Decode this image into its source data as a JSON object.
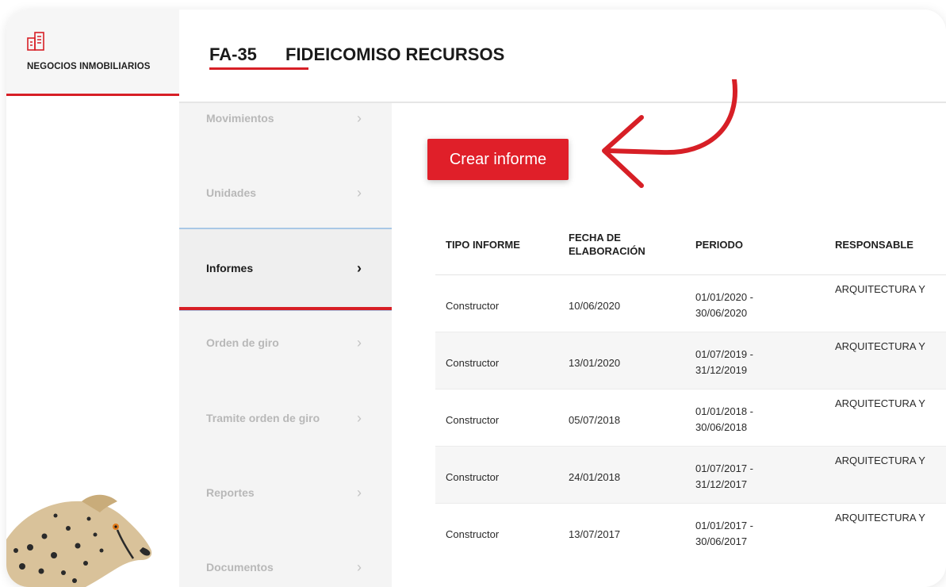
{
  "brand": {
    "name": "NEGOCIOS INMOBILIARIOS",
    "icon": "building-icon",
    "accent": "#d71f26"
  },
  "header": {
    "code": "FA-35",
    "title": "FIDEICOMISO RECURSOS"
  },
  "nav": {
    "items": [
      {
        "label": "Movimientos"
      },
      {
        "label": "Unidades"
      },
      {
        "label": "Informes",
        "active": true
      },
      {
        "label": "Orden de giro"
      },
      {
        "label": "Tramite orden de giro"
      },
      {
        "label": "Reportes"
      },
      {
        "label": "Documentos"
      }
    ]
  },
  "main": {
    "create_button": "Crear informe",
    "table": {
      "headers": [
        "TIPO INFORME",
        "FECHA DE ELABORACIÓN",
        "PERIODO",
        "RESPONSABLE"
      ],
      "rows": [
        {
          "tipo": "Constructor",
          "fecha": "10/06/2020",
          "periodo_start": "01/01/2020 -",
          "periodo_end": "30/06/2020",
          "responsable": "ARQUITECTURA Y"
        },
        {
          "tipo": "Constructor",
          "fecha": "13/01/2020",
          "periodo_start": "01/07/2019 -",
          "periodo_end": "31/12/2019",
          "responsable": "ARQUITECTURA Y"
        },
        {
          "tipo": "Constructor",
          "fecha": "05/07/2018",
          "periodo_start": "01/01/2018 -",
          "periodo_end": "30/06/2018",
          "responsable": "ARQUITECTURA Y"
        },
        {
          "tipo": "Constructor",
          "fecha": "24/01/2018",
          "periodo_start": "01/07/2017 -",
          "periodo_end": "31/12/2017",
          "responsable": "ARQUITECTURA Y"
        },
        {
          "tipo": "Constructor",
          "fecha": "13/07/2017",
          "periodo_start": "01/01/2017 -",
          "periodo_end": "30/06/2017",
          "responsable": "ARQUITECTURA Y"
        }
      ]
    }
  }
}
